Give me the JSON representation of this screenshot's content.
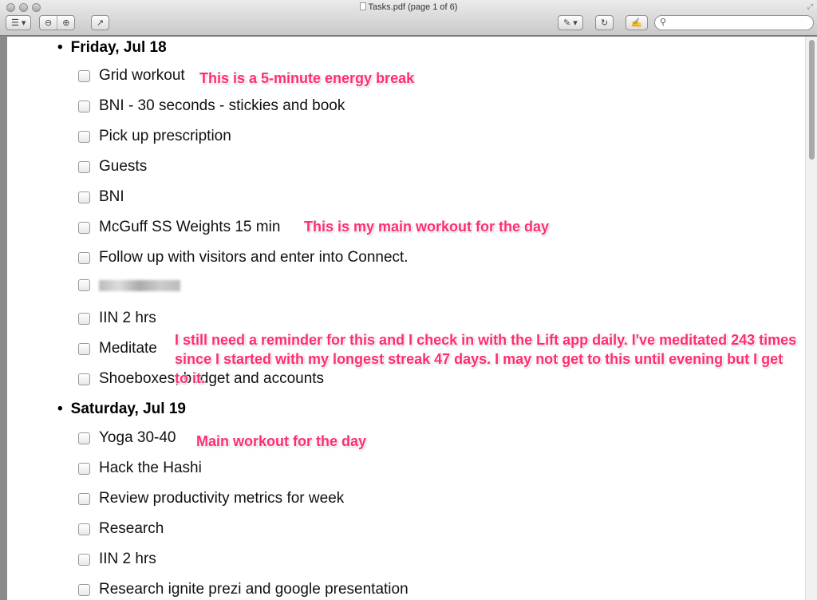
{
  "window": {
    "title": "Tasks.pdf (page 1 of 6)"
  },
  "toolbar": {
    "sidebar": "☰ ▾",
    "zoom_out": "⊖",
    "zoom_in": "⊕",
    "share": "↗",
    "annotate": "✎ ▾",
    "rotate": "↻",
    "edit": "✍",
    "search_placeholder": "",
    "search_icon": "⚲"
  },
  "accent": "#ff2d6f",
  "days": [
    {
      "label": "Friday, Jul 18",
      "tasks": [
        "Grid workout",
        "BNI - 30 seconds - stickies and book",
        "Pick up prescription",
        "Guests",
        "BNI",
        "McGuff SS Weights 15 min",
        "Follow up with visitors and enter into Connect.",
        "",
        "IIN 2 hrs",
        "Meditate",
        "Shoeboxes, budget and accounts"
      ]
    },
    {
      "label": "Saturday, Jul 19",
      "tasks": [
        "Yoga 30-40",
        "Hack the Hashi",
        "Review productivity metrics for week",
        "Research",
        "IIN 2 hrs",
        "Research ignite prezi and google presentation"
      ]
    }
  ],
  "notes": {
    "grid": "This is a 5-minute energy break",
    "mcguff": "This is my main workout for the day",
    "meditate": "I still need a reminder for this and I check in with the Lift app daily. I've meditated 243 times since I started with my longest streak 47 days. I may not get to this until evening but I get to it.",
    "yoga": "Main workout for the day"
  }
}
